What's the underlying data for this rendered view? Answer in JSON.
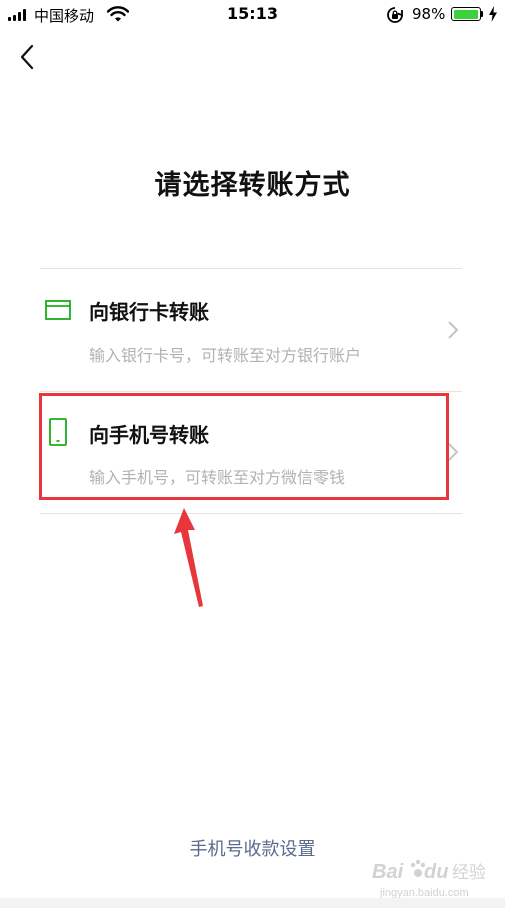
{
  "status_bar": {
    "carrier": "中国移动",
    "time": "15:13",
    "battery_percent": "98%",
    "battery_level": 0.98,
    "icons": [
      "signal-icon",
      "wifi-icon",
      "rotation-lock-icon",
      "battery-icon",
      "charging-bolt-icon"
    ]
  },
  "nav": {
    "back_icon": "chevron-left-icon"
  },
  "title": "请选择转账方式",
  "options": [
    {
      "label": "向银行卡转账",
      "description": "输入银行卡号，可转账至对方银行账户",
      "icon": "bank-card-icon"
    },
    {
      "label": "向手机号转账",
      "description": "输入手机号，可转账至对方微信零钱",
      "icon": "phone-icon"
    }
  ],
  "footer": {
    "link": "手机号收款设置"
  },
  "watermark": {
    "text": "Baidu经验",
    "subtext": "jingyan.baidu.com"
  },
  "colors": {
    "accent": "#1aad19",
    "highlight": "#e8363d",
    "link": "#586b8c"
  }
}
